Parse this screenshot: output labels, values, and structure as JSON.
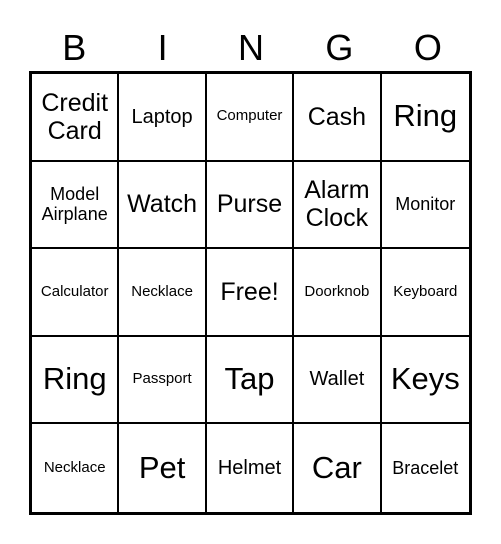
{
  "header": [
    "B",
    "I",
    "N",
    "G",
    "O"
  ],
  "cells": [
    [
      "Credit Card",
      "Laptop",
      "Computer",
      "Cash",
      "Ring"
    ],
    [
      "Model Airplane",
      "Watch",
      "Purse",
      "Alarm Clock",
      "Monitor"
    ],
    [
      "Calculator",
      "Necklace",
      "Free!",
      "Doorknob",
      "Keyboard"
    ],
    [
      "Ring",
      "Passport",
      "Tap",
      "Wallet",
      "Keys"
    ],
    [
      "Necklace",
      "Pet",
      "Helmet",
      "Car",
      "Bracelet"
    ]
  ]
}
